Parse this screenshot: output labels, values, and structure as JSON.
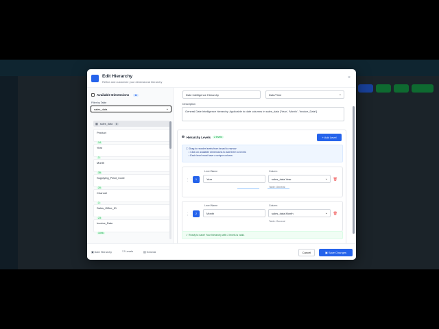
{
  "modal": {
    "title": "Edit Hierarchy",
    "subtitle": "Refine and customize your dimensional hierarchy",
    "close_icon": "×"
  },
  "left": {
    "title": "Available Dimensions",
    "count": "11",
    "filter_label": "Filter by Table",
    "filter_value": "sales_data",
    "table_name": "sales_data",
    "table_count": "8",
    "items": [
      {
        "name": "Product",
        "count": "14"
      },
      {
        "name": "Year",
        "count": "3"
      },
      {
        "name": "Month",
        "count": "35"
      },
      {
        "name": "Supplying_Plant_Code",
        "count": "20"
      },
      {
        "name": "Channel",
        "count": "3"
      },
      {
        "name": "Sales_Office_ID",
        "count": "23"
      },
      {
        "name": "Invoice_Date",
        "count": "1096"
      }
    ]
  },
  "right": {
    "name_value": "Date Intelligence Hierarchy",
    "type_value": "Date/Time",
    "desc_label": "Description",
    "desc_value": "General Date Intelligence hierarchy. Applicable to date columns in sales_data ['Year', 'Month', 'Invoice_Date']",
    "levels_title": "Hierarchy Levels",
    "levels_badge": "2 levels",
    "add_level": "+ Add Level",
    "info_title": "Drag to reorder levels from broad to narrow",
    "info_line1": "• Click on available dimensions to add them to levels",
    "info_line2": "• Each level must have a unique column",
    "level_name_label": "Level Name",
    "column_label": "Column",
    "levels": [
      {
        "num": "1",
        "name": "Year",
        "column": "sales_data.Year",
        "table": "Table: General"
      },
      {
        "num": "2",
        "name": "Month",
        "column": "sales_data.Month",
        "table": "Table: General"
      }
    ],
    "ready": "Ready to save! Your hierarchy with 2 levels is valid."
  },
  "footer": {
    "type": "Date Hierarchy",
    "levels": "2 Levels",
    "category": "General",
    "cancel": "Cancel",
    "save": "Save Changes"
  },
  "colors": {
    "accent": "#2563eb",
    "success": "#16a34a",
    "danger": "#ef4444"
  }
}
